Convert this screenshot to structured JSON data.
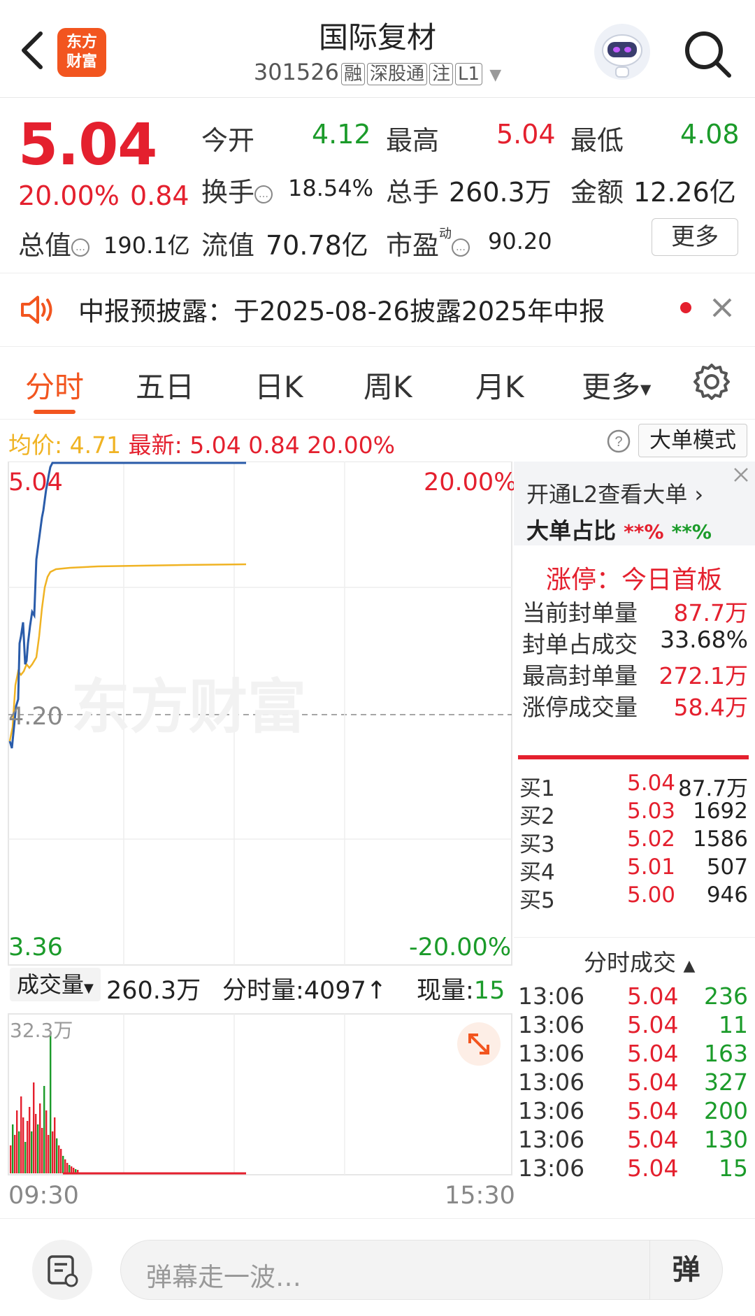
{
  "header": {
    "title": "国际复材",
    "code": "301526",
    "tags": [
      "融",
      "深股通",
      "注",
      "L1"
    ],
    "logo_text_line1": "东方",
    "logo_text_line2": "财富"
  },
  "quote": {
    "price": "5.04",
    "change_pct": "20.00%",
    "change_amt": "0.84",
    "open_label": "今开",
    "open_value": "4.12",
    "high_label": "最高",
    "high_value": "5.04",
    "low_label": "最低",
    "low_value": "4.08",
    "turnover_label": "换手",
    "turnover_value": "18.54%",
    "volume_label": "总手",
    "volume_value": "260.3万",
    "amount_label": "金额",
    "amount_value": "12.26亿",
    "mktcap_label": "总值",
    "mktcap_value": "190.1亿",
    "float_label": "流值",
    "float_value": "70.78亿",
    "pe_label": "市盈",
    "pe_sup": "动",
    "pe_value": "90.20",
    "more_label": "更多"
  },
  "notice": {
    "text": "中报预披露：于2025-08-26披露2025年中报"
  },
  "tabs": [
    "分时",
    "五日",
    "日K",
    "周K",
    "月K",
    "更多"
  ],
  "avg_row": {
    "avg_label": "均价:",
    "avg_value": "4.71",
    "latest_label": "最新:",
    "latest_value": "5.04",
    "change_amt": "0.84",
    "change_pct": "20.00%",
    "bigorder_label": "大单模式"
  },
  "chart": {
    "price_top": "5.04",
    "price_mid": "4.20",
    "price_bottom": "3.36",
    "pct_top": "20.00%",
    "pct_bottom": "-20.00%",
    "time_start": "09:30",
    "time_end": "15:30",
    "watermark": "东方财富",
    "colors": {
      "price": "#2a5caa",
      "avg": "#f0b323",
      "up": "#e4202e",
      "down": "#1b9b2a"
    }
  },
  "volume": {
    "select_label": "成交量",
    "total": "260.3万",
    "tick_label": "分时量:4097↑",
    "now_label": "现量:",
    "now_value": "15",
    "max_label": "32.3万"
  },
  "right_panel": {
    "l2_link": "开通L2查看大单",
    "ratio_label": "大单占比",
    "ratio_buy": "**%",
    "ratio_sell": "**%",
    "limit_title": "涨停：今日首板",
    "stats": [
      {
        "label": "当前封单量",
        "value": "87.7万"
      },
      {
        "label": "封单占成交",
        "value": "33.68%"
      },
      {
        "label": "最高封单量",
        "value": "272.1万"
      },
      {
        "label": "涨停成交量",
        "value": "58.4万"
      }
    ],
    "bids": [
      {
        "label": "买1",
        "price": "5.04",
        "vol": "87.7万"
      },
      {
        "label": "买2",
        "price": "5.03",
        "vol": "1692"
      },
      {
        "label": "买3",
        "price": "5.02",
        "vol": "1586"
      },
      {
        "label": "买4",
        "price": "5.01",
        "vol": "507"
      },
      {
        "label": "买5",
        "price": "5.00",
        "vol": "946"
      }
    ],
    "trades_title": "分时成交",
    "trades": [
      {
        "time": "13:06",
        "price": "5.04",
        "vol": "236"
      },
      {
        "time": "13:06",
        "price": "5.04",
        "vol": "11"
      },
      {
        "time": "13:06",
        "price": "5.04",
        "vol": "163"
      },
      {
        "time": "13:06",
        "price": "5.04",
        "vol": "327"
      },
      {
        "time": "13:06",
        "price": "5.04",
        "vol": "200"
      },
      {
        "time": "13:06",
        "price": "5.04",
        "vol": "130"
      },
      {
        "time": "13:06",
        "price": "5.04",
        "vol": "15"
      }
    ]
  },
  "bottom": {
    "placeholder": "弹幕走一波…",
    "toggle_label": "弹"
  }
}
